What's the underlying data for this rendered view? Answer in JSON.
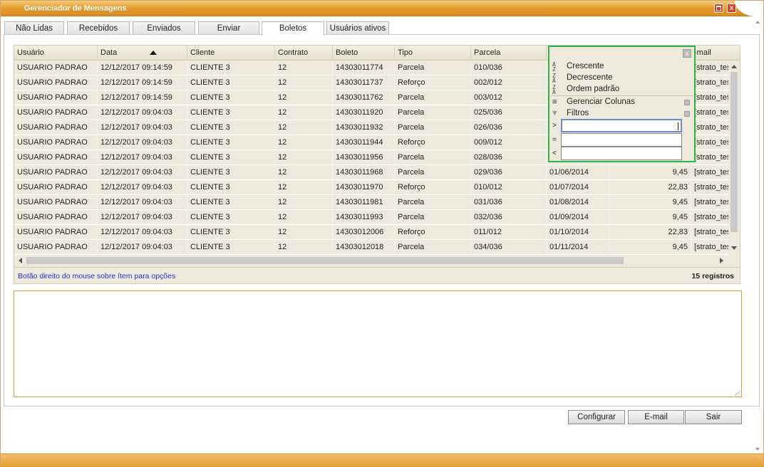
{
  "window": {
    "title": "Gerenciador de Mensagens",
    "close_glyph": "x"
  },
  "tabs": [
    {
      "label": "Não Lidas"
    },
    {
      "label": "Recebidos"
    },
    {
      "label": "Enviados"
    },
    {
      "label": "Enviar"
    },
    {
      "label": "Boletos"
    },
    {
      "label": "Usuários ativos"
    }
  ],
  "active_tab": "Boletos",
  "grid": {
    "columns": [
      "Usuário",
      "Data",
      "Cliente",
      "Contrato",
      "Boleto",
      "Tipo",
      "Parcela",
      "",
      "",
      "E-mail"
    ],
    "email_header_visible": "-mail",
    "sort_column": "Data",
    "sort_direction": "ascending",
    "rows": [
      [
        "USUARIO PADRAO",
        "12/12/2017 09:14:59",
        "CLIENTE 3",
        "12",
        "14303011774",
        "Parcela",
        "010/036",
        "",
        "",
        "[strato_test"
      ],
      [
        "USUARIO PADRAO",
        "12/12/2017 09:14:59",
        "CLIENTE 3",
        "12",
        "14303011737",
        "Reforço",
        "002/012",
        "",
        "",
        "[strato_test"
      ],
      [
        "USUARIO PADRAO",
        "12/12/2017 09:14:59",
        "CLIENTE 3",
        "12",
        "14303011762",
        "Parcela",
        "003/012",
        "",
        "",
        "[strato_test"
      ],
      [
        "USUARIO PADRAO",
        "12/12/2017 09:04:03",
        "CLIENTE 3",
        "12",
        "14303011920",
        "Parcela",
        "025/036",
        "",
        "",
        "[strato_test"
      ],
      [
        "USUARIO PADRAO",
        "12/12/2017 09:04:03",
        "CLIENTE 3",
        "12",
        "14303011932",
        "Parcela",
        "026/036",
        "",
        "",
        "[strato_test"
      ],
      [
        "USUARIO PADRAO",
        "12/12/2017 09:04:03",
        "CLIENTE 3",
        "12",
        "14303011944",
        "Reforço",
        "009/012",
        "",
        "",
        "[strato_test"
      ],
      [
        "USUARIO PADRAO",
        "12/12/2017 09:04:03",
        "CLIENTE 3",
        "12",
        "14303011956",
        "Parcela",
        "028/036",
        "",
        "",
        "[strato_test"
      ],
      [
        "USUARIO PADRAO",
        "12/12/2017 09:04:03",
        "CLIENTE 3",
        "12",
        "14303011968",
        "Parcela",
        "029/036",
        "01/06/2014",
        "9,45",
        "[strato_test"
      ],
      [
        "USUARIO PADRAO",
        "12/12/2017 09:04:03",
        "CLIENTE 3",
        "12",
        "14303011970",
        "Reforço",
        "010/012",
        "01/07/2014",
        "22,83",
        "[strato_test"
      ],
      [
        "USUARIO PADRAO",
        "12/12/2017 09:04:03",
        "CLIENTE 3",
        "12",
        "14303011981",
        "Parcela",
        "031/036",
        "01/08/2014",
        "9,45",
        "[strato_test"
      ],
      [
        "USUARIO PADRAO",
        "12/12/2017 09:04:03",
        "CLIENTE 3",
        "12",
        "14303011993",
        "Parcela",
        "032/036",
        "01/09/2014",
        "9,45",
        "[strato_test"
      ],
      [
        "USUARIO PADRAO",
        "12/12/2017 09:04:03",
        "CLIENTE 3",
        "12",
        "14303012006",
        "Reforço",
        "011/012",
        "01/10/2014",
        "22,83",
        "[strato_test"
      ],
      [
        "USUARIO PADRAO",
        "12/12/2017 09:04:03",
        "CLIENTE 3",
        "12",
        "14303012018",
        "Parcela",
        "034/036",
        "01/11/2014",
        "9,45",
        "[strato_test"
      ]
    ],
    "footer_hint": "Botão direito do mouse sobre ítem para opções",
    "record_count": "15 registros"
  },
  "context_menu": {
    "close_glyph": "x",
    "items": {
      "sort_asc": "Crescente",
      "sort_desc": "Decrescente",
      "sort_default": "Ordem padrão",
      "manage_columns": "Gerenciar Colunas",
      "filters": "Filtros"
    },
    "filter_ops": {
      "gt": ">",
      "eq": "=",
      "lt": "<"
    },
    "filter_values": {
      "gt": "",
      "eq": "",
      "lt": ""
    }
  },
  "message_body": "",
  "buttons": {
    "configurar": "Configurar",
    "email": "E-mail",
    "sair": "Sair"
  },
  "colors": {
    "titlebar": "#e49a2a",
    "grid_bg": "#eeeadb",
    "popup_border": "#2fb44a",
    "hint": "#2a2adf"
  }
}
